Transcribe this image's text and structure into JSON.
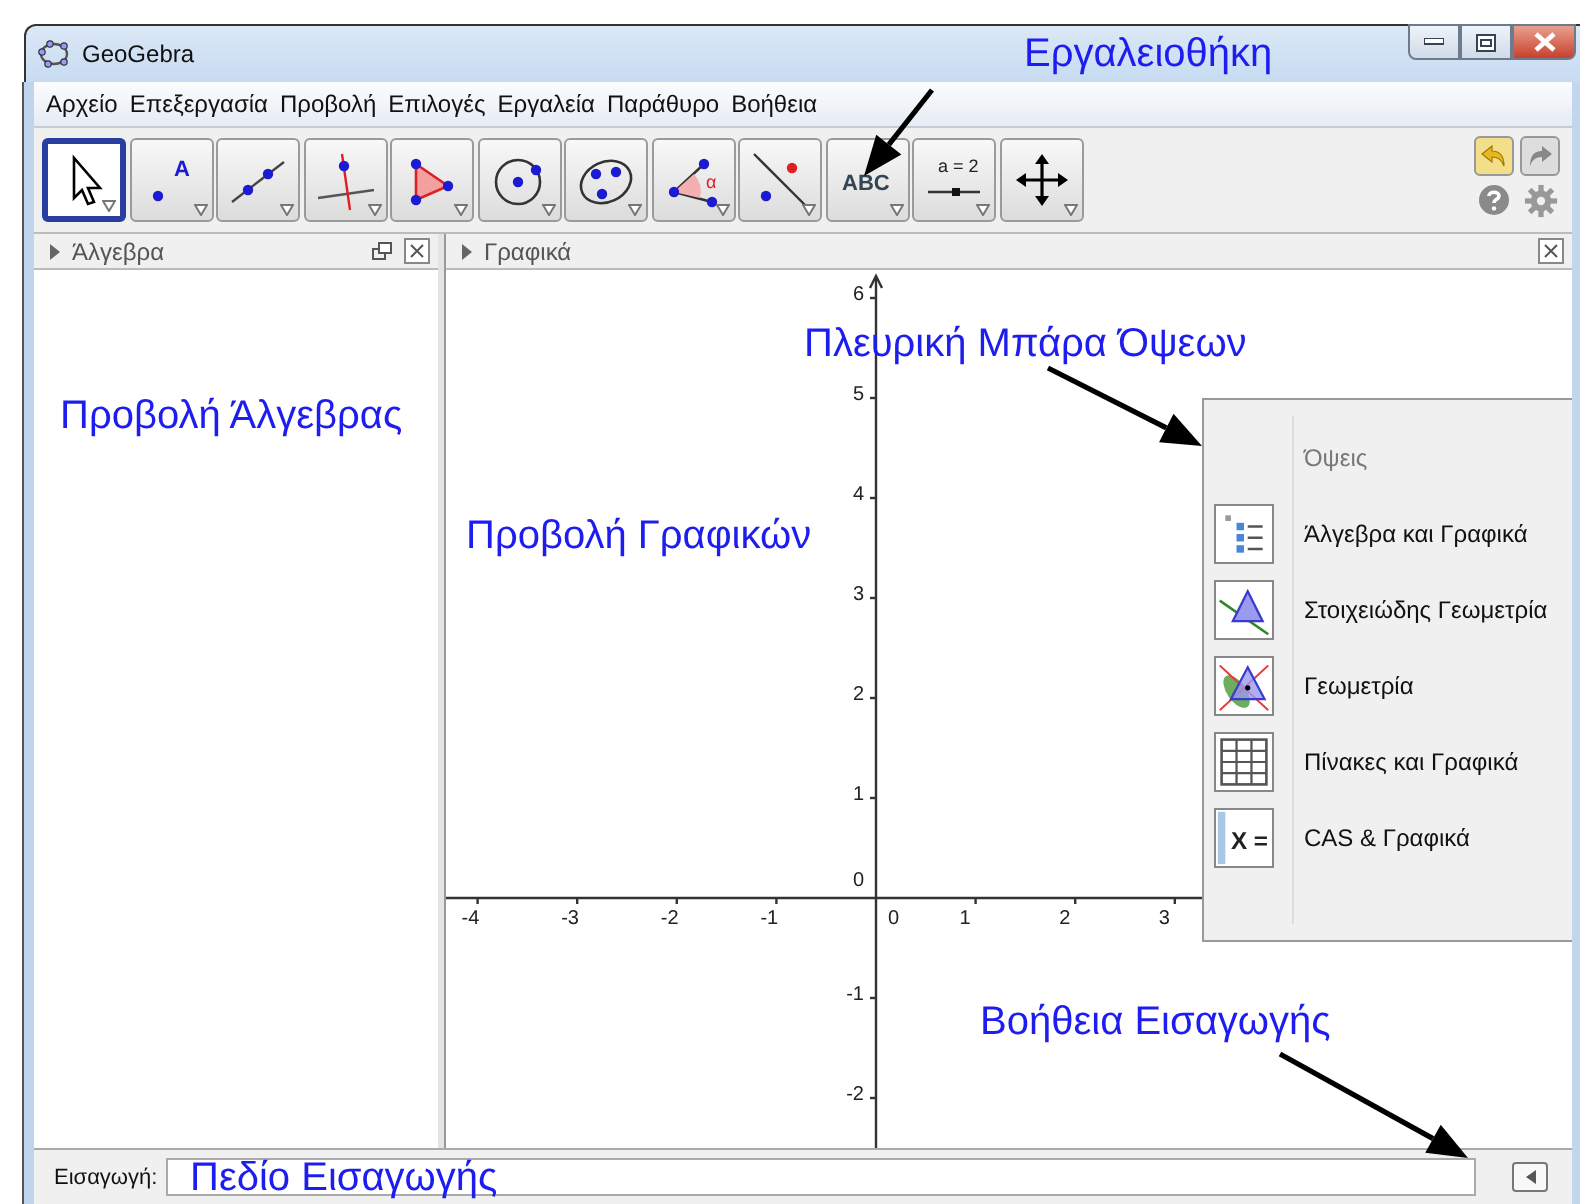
{
  "window": {
    "title": "GeoGebra"
  },
  "menu": [
    "Αρχείο",
    "Επεξεργασία",
    "Προβολή",
    "Επιλογές",
    "Εργαλεία",
    "Παράθυρο",
    "Βοήθεια"
  ],
  "tools": [
    {
      "kind": "move",
      "selected": true
    },
    {
      "kind": "point",
      "selected": false,
      "label": "A"
    },
    {
      "kind": "line",
      "selected": false
    },
    {
      "kind": "perpendicular",
      "selected": false
    },
    {
      "kind": "polygon",
      "selected": false
    },
    {
      "kind": "circle",
      "selected": false
    },
    {
      "kind": "conic",
      "selected": false
    },
    {
      "kind": "angle",
      "selected": false,
      "label": "α"
    },
    {
      "kind": "reflect",
      "selected": false
    },
    {
      "kind": "text",
      "selected": false,
      "label": "ABC"
    },
    {
      "kind": "slider",
      "selected": false,
      "label": "a = 2"
    },
    {
      "kind": "translate",
      "selected": false
    }
  ],
  "algebra": {
    "title": "Άλγεβρα"
  },
  "graphics": {
    "title": "Γραφικά",
    "x_tick_labels": [
      "-4",
      "-3",
      "-2",
      "-1",
      "0",
      "1",
      "2",
      "3"
    ],
    "y_tick_labels": [
      "6",
      "5",
      "4",
      "3",
      "2",
      "1",
      "0",
      "-1",
      "-2"
    ]
  },
  "views_sidebar": {
    "title": "Όψεις",
    "items": [
      {
        "kind": "algebra",
        "label": "Άλγεβρα και Γραφικά"
      },
      {
        "kind": "basic",
        "label": "Στοιχειώδης Γεωμετρία"
      },
      {
        "kind": "geometry",
        "label": "Γεωμετρία"
      },
      {
        "kind": "spreadsheet",
        "label": "Πίνακες και Γραφικά"
      },
      {
        "kind": "cas",
        "label": "CAS & Γραφικά",
        "icon_text": "X ="
      }
    ]
  },
  "input_bar": {
    "label": "Εισαγωγή:"
  },
  "annotations": [
    {
      "text": "Εργαλειοθήκη"
    },
    {
      "text": "Πλευρική Μπάρα Όψεων"
    },
    {
      "text": "Προβολή Άλγεβρας"
    },
    {
      "text": "Προβολή Γραφικών"
    },
    {
      "text": "Βοήθεια Εισαγωγής"
    },
    {
      "text": "Πεδίο Εισαγωγής"
    }
  ]
}
